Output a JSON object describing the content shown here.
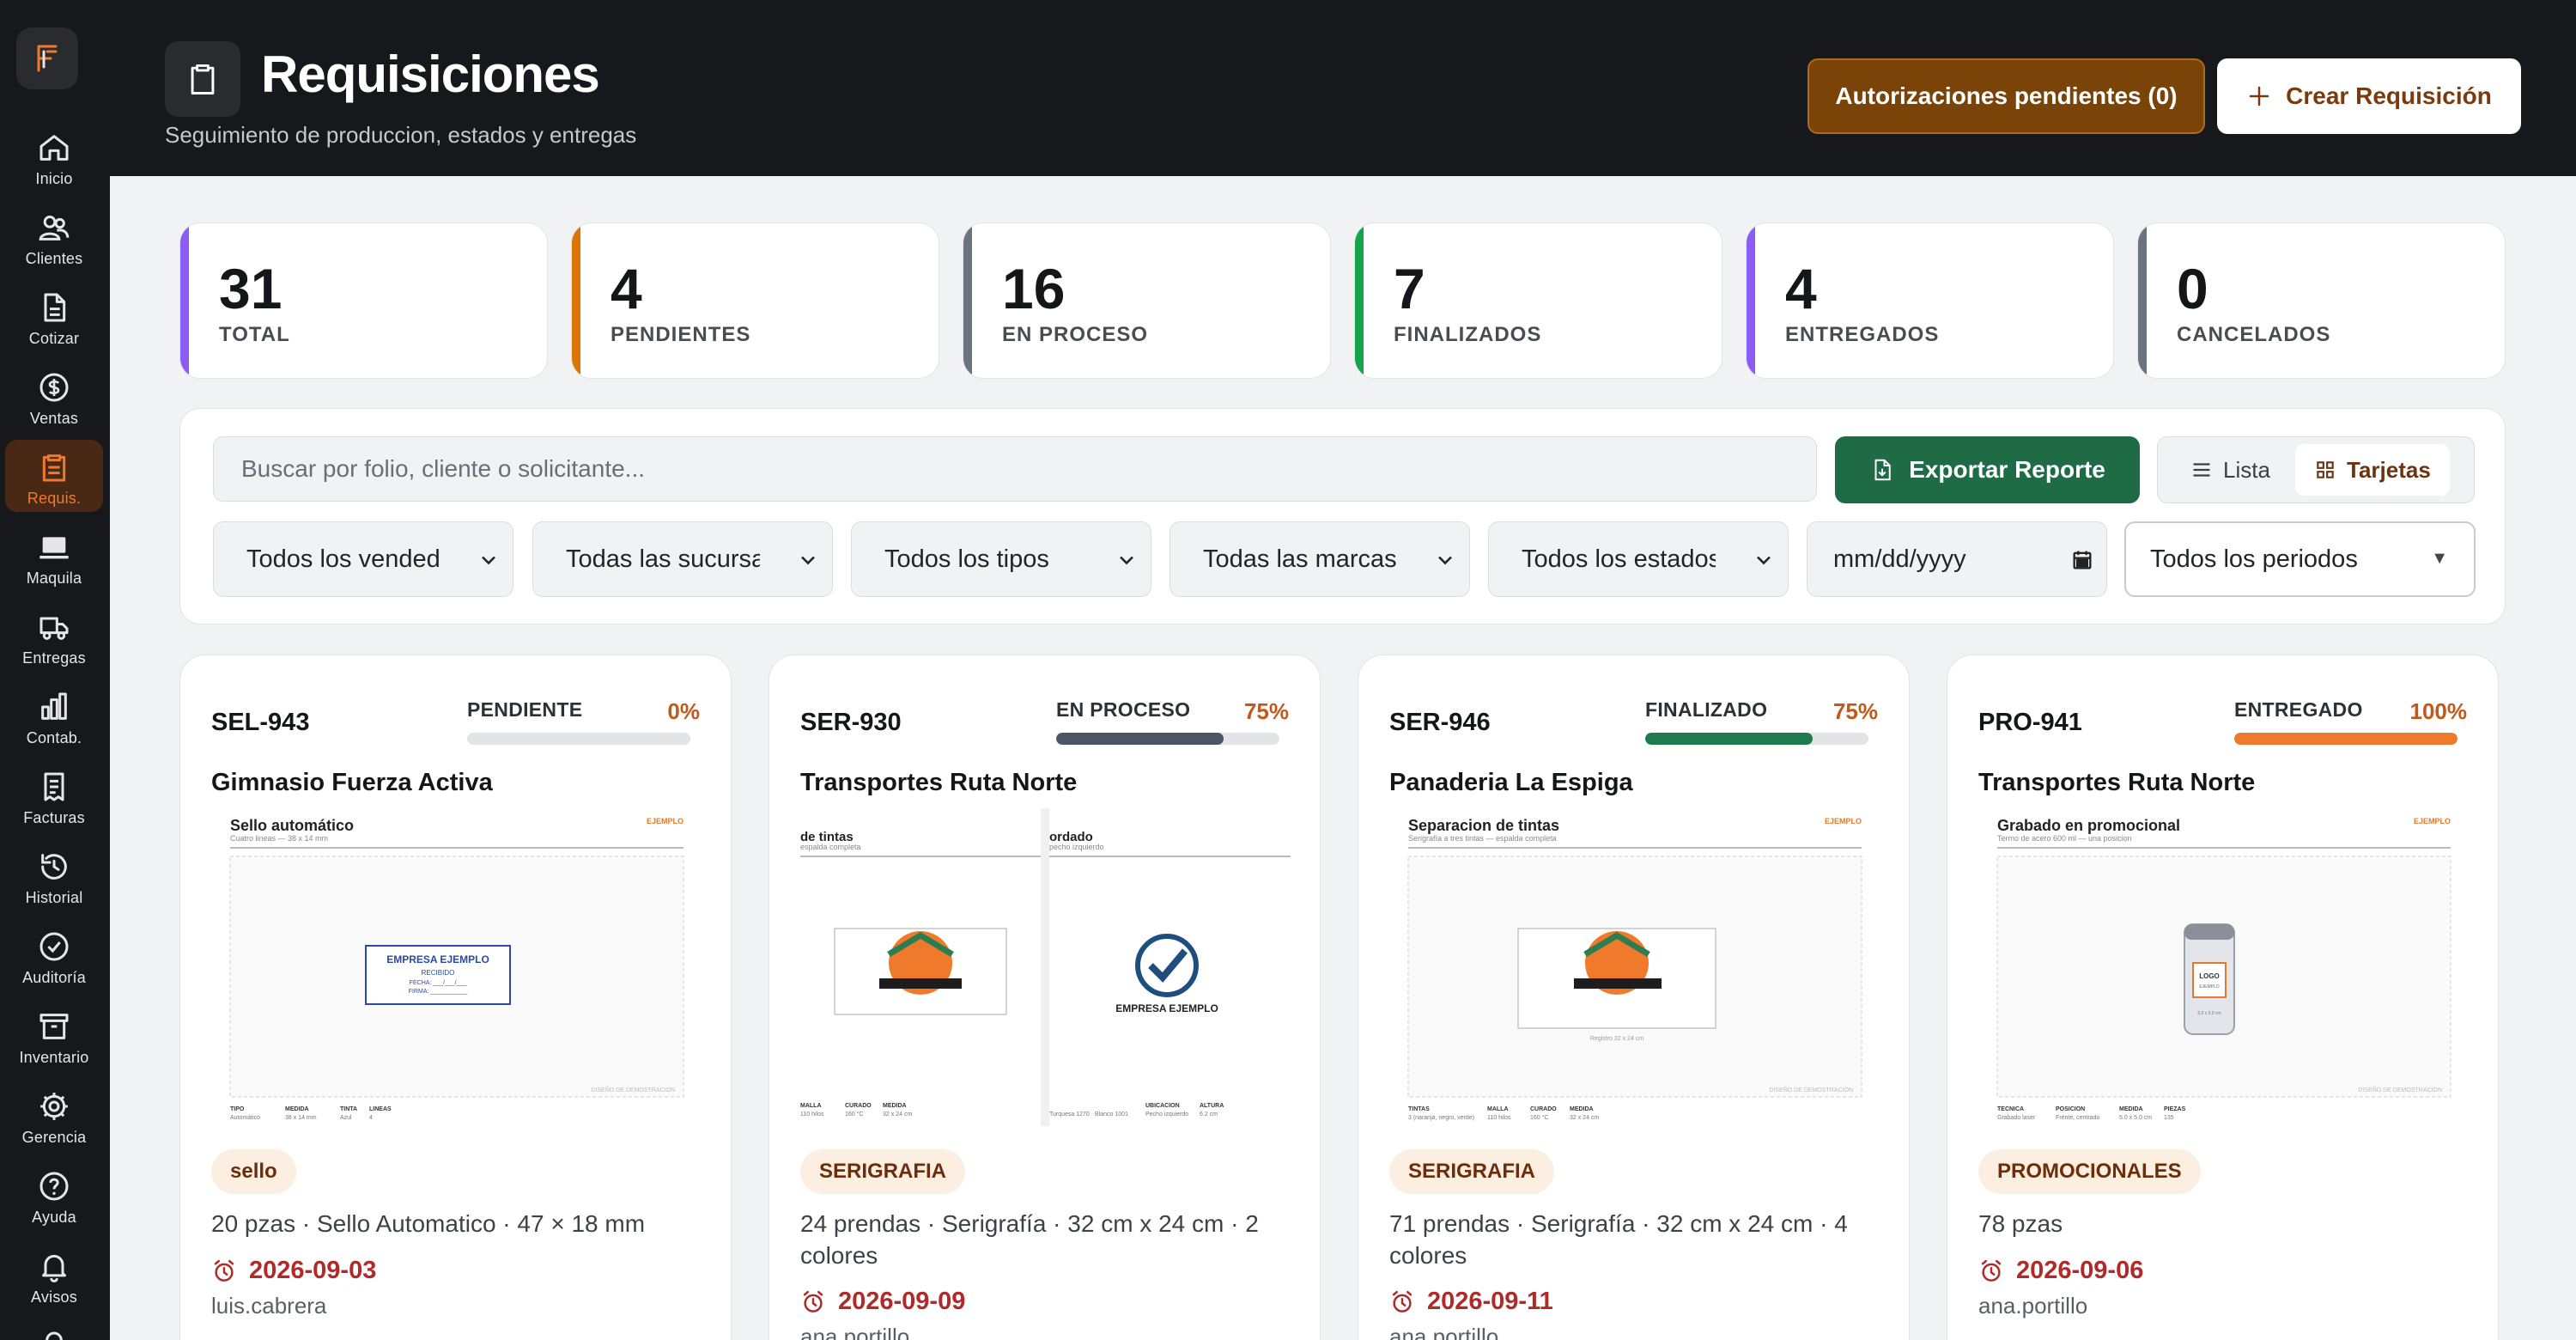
{
  "sidebar": {
    "items": [
      {
        "label": "Inicio",
        "icon": "home-icon"
      },
      {
        "label": "Clientes",
        "icon": "users-icon"
      },
      {
        "label": "Cotizar",
        "icon": "document-icon"
      },
      {
        "label": "Ventas",
        "icon": "dollar-icon"
      },
      {
        "label": "Requis.",
        "icon": "clipboard-icon",
        "active": true
      },
      {
        "label": "Maquila",
        "icon": "laptop-icon"
      },
      {
        "label": "Entregas",
        "icon": "truck-icon"
      },
      {
        "label": "Contab.",
        "icon": "bar-chart-icon"
      },
      {
        "label": "Facturas",
        "icon": "receipt-icon"
      },
      {
        "label": "Historial",
        "icon": "history-icon"
      },
      {
        "label": "Auditoría",
        "icon": "check-circle-icon"
      },
      {
        "label": "Inventario",
        "icon": "archive-icon"
      },
      {
        "label": "Gerencia",
        "icon": "gear-icon"
      },
      {
        "label": "Ayuda",
        "icon": "help-icon"
      },
      {
        "label": "Avisos",
        "icon": "bell-icon"
      }
    ]
  },
  "header": {
    "title": "Requisiciones",
    "subtitle": "Seguimiento de produccion, estados y entregas",
    "auth_button": "Autorizaciones pendientes (0)",
    "create_button": "Crear Requisición"
  },
  "stats": [
    {
      "value": "31",
      "label": "TOTAL",
      "color": "#8b5cf6"
    },
    {
      "value": "4",
      "label": "PENDIENTES",
      "color": "#d97706"
    },
    {
      "value": "16",
      "label": "EN PROCESO",
      "color": "#6b7280"
    },
    {
      "value": "7",
      "label": "FINALIZADOS",
      "color": "#16a34a"
    },
    {
      "value": "4",
      "label": "ENTREGADOS",
      "color": "#8b5cf6"
    },
    {
      "value": "0",
      "label": "CANCELADOS",
      "color": "#6b7280"
    }
  ],
  "filters": {
    "search_placeholder": "Buscar por folio, cliente o solicitante...",
    "export_button": "Exportar Reporte",
    "view_list": "Lista",
    "view_cards": "Tarjetas",
    "selects": [
      "Todos los vendedores",
      "Todas las sucursales",
      "Todos los tipos",
      "Todas las marcas",
      "Todos los estados"
    ],
    "date_placeholder": "mm/dd/yyyy",
    "period": "Todos los periodos"
  },
  "cards": [
    {
      "folio": "SEL-943",
      "status": "PENDIENTE",
      "percent": "0%",
      "progress": 0,
      "bar_color": "#9ca3af",
      "client": "Gimnasio Fuerza Activa",
      "tag": "sello",
      "description": "20 pzas · Sello Automatico · 47 × 18 mm",
      "date": "2026-09-03",
      "user": "luis.cabrera",
      "preview": {
        "title": "Sello automático",
        "subtitle": "Cuatro lineas — 38 x 14 mm",
        "brand": "EJEMPLO",
        "stamp_company": "EMPRESA EJEMPLO",
        "stamp_line2": "RECIBIDO",
        "stamp_line3": "FECHA: ___/___/___",
        "stamp_line4": "FIRMA: ___________",
        "footer_note": "DISEÑO DE DEMOSTRACION",
        "specs": [
          {
            "k": "TIPO",
            "v": "Automático"
          },
          {
            "k": "MEDIDA",
            "v": "38 x 14 mm"
          },
          {
            "k": "TINTA",
            "v": "Azul"
          },
          {
            "k": "LINEAS",
            "v": "4"
          }
        ]
      }
    },
    {
      "folio": "SER-930",
      "status": "EN PROCESO",
      "percent": "75%",
      "progress": 75,
      "bar_color": "#4b5563",
      "client": "Transportes Ruta Norte",
      "tag": "SERIGRAFIA",
      "description": "24 prendas · Serigrafía · 32 cm x 24 cm · 2 colores",
      "date": "2026-09-09",
      "user": "ana.portillo",
      "preview": {
        "left_title": "de tintas",
        "left_sub": "espalda completa",
        "right_title": "ordado",
        "right_sub": "pecho izquierdo",
        "right_company": "EMPRESA EJEMPLO",
        "left_specs": [
          {
            "k": "MALLA",
            "v": "110 hilos"
          },
          {
            "k": "CURADO",
            "v": "160 °C"
          },
          {
            "k": "MEDIDA",
            "v": "32 x 24 cm"
          }
        ],
        "right_specs": [
          {
            "k": "",
            "v": "Turquesa 1270 · Blanco 1001"
          },
          {
            "k": "UBICACION",
            "v": "Pecho izquierdo"
          },
          {
            "k": "ALTURA",
            "v": "6.2 cm"
          }
        ]
      }
    },
    {
      "folio": "SER-946",
      "status": "FINALIZADO",
      "percent": "75%",
      "progress": 75,
      "bar_color": "#1f7a4d",
      "client": "Panaderia La Espiga",
      "tag": "SERIGRAFIA",
      "description": "71 prendas · Serigrafía · 32 cm x 24 cm · 4 colores",
      "date": "2026-09-11",
      "user": "ana.portillo",
      "preview": {
        "title": "Separacion de tintas",
        "subtitle": "Serigrafía a tres tintas — espalda completa",
        "brand": "EJEMPLO",
        "caption": "Registro 32 x 24 cm",
        "footer_note": "DISEÑO DE DEMOSTRACION",
        "specs": [
          {
            "k": "TINTAS",
            "v": "3 (naranja, negro, verde)"
          },
          {
            "k": "MALLA",
            "v": "110 hilos"
          },
          {
            "k": "CURADO",
            "v": "160 °C"
          },
          {
            "k": "MEDIDA",
            "v": "32 x 24 cm"
          }
        ]
      }
    },
    {
      "folio": "PRO-941",
      "status": "ENTREGADO",
      "percent": "100%",
      "progress": 100,
      "bar_color": "#f07a2c",
      "client": "Transportes Ruta Norte",
      "tag": "PROMOCIONALES",
      "description": "78 pzas",
      "date": "2026-09-06",
      "user": "ana.portillo",
      "preview": {
        "title": "Grabado en promocional",
        "subtitle": "Termo de acero 600 ml — una posicion",
        "brand": "EJEMPLO",
        "logo_text": "LOGO",
        "logo_sub": "EJEMPLO",
        "caption": "5.0 x 5.0 cm",
        "footer_note": "DISEÑO DE DEMOSTRACION",
        "specs": [
          {
            "k": "TECNICA",
            "v": "Grabado laser"
          },
          {
            "k": "POSICION",
            "v": "Frente, centrado"
          },
          {
            "k": "MEDIDA",
            "v": "5.0 x 5.0 cm"
          },
          {
            "k": "PIEZAS",
            "v": "135"
          }
        ]
      }
    }
  ],
  "colors": {
    "sidebar_bg": "#17181b",
    "accent": "#f07a2c",
    "export_green": "#1f6b45",
    "auth_brown": "#7a4408",
    "date_red": "#b02a2a"
  }
}
